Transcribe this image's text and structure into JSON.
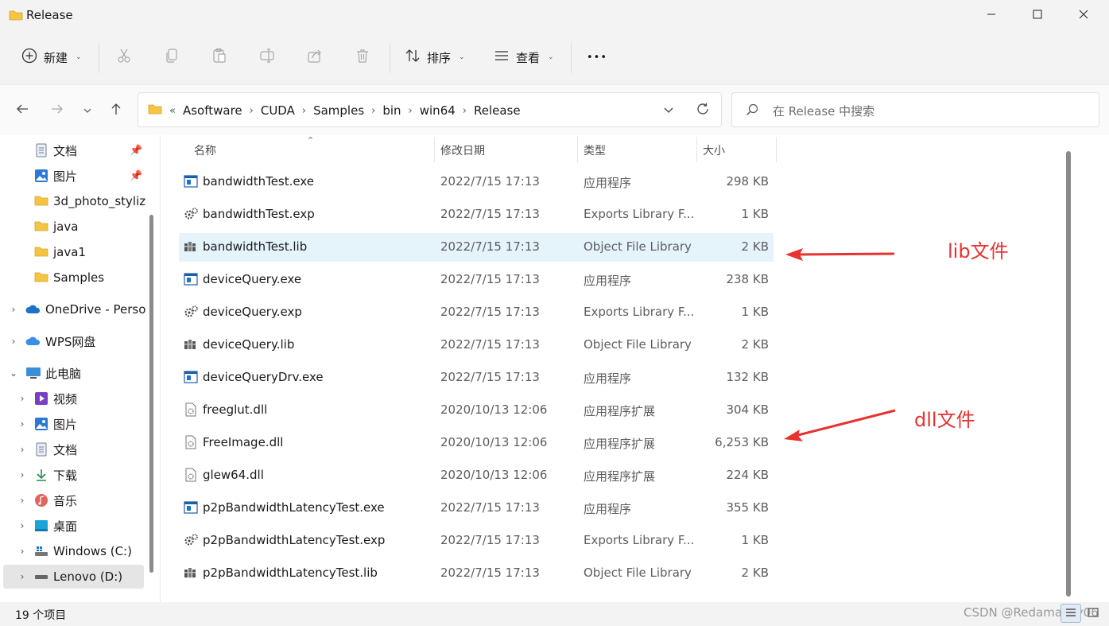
{
  "window": {
    "title": "Release",
    "controls": {
      "minimize": "minimize-icon",
      "maximize": "maximize-icon",
      "close": "close-icon"
    }
  },
  "toolbar": {
    "new_label": "新建",
    "sort_label": "排序",
    "view_label": "查看",
    "more_label": "•••",
    "icons": [
      "cut-icon",
      "copy-icon",
      "paste-icon",
      "rename-icon",
      "share-icon",
      "delete-icon"
    ]
  },
  "address": {
    "overflow": "«",
    "crumbs": [
      "Asoftware",
      "CUDA",
      "Samples",
      "bin",
      "win64",
      "Release"
    ],
    "search_placeholder": "在 Release 中搜索"
  },
  "sidebar": {
    "items": [
      {
        "label": "文档",
        "icon": "document-icon",
        "pinned": true
      },
      {
        "label": "图片",
        "icon": "picture-icon",
        "pinned": true
      },
      {
        "label": "3d_photo_styliz",
        "icon": "folder-icon"
      },
      {
        "label": "java",
        "icon": "folder-icon"
      },
      {
        "label": "java1",
        "icon": "folder-icon"
      },
      {
        "label": "Samples",
        "icon": "folder-icon"
      },
      {
        "label": "OneDrive - Perso",
        "icon": "onedrive-icon"
      },
      {
        "label": "WPS网盘",
        "icon": "wps-cloud-icon"
      },
      {
        "label": "此电脑",
        "icon": "this-pc-icon"
      },
      {
        "label": "视频",
        "icon": "video-icon"
      },
      {
        "label": "图片",
        "icon": "picture-icon"
      },
      {
        "label": "文档",
        "icon": "document-icon"
      },
      {
        "label": "下载",
        "icon": "download-icon"
      },
      {
        "label": "音乐",
        "icon": "music-icon"
      },
      {
        "label": "桌面",
        "icon": "desktop-icon"
      },
      {
        "label": "Windows (C:)",
        "icon": "drive-icon"
      },
      {
        "label": "Lenovo (D:)",
        "icon": "drive-icon"
      }
    ]
  },
  "columns": {
    "name": "名称",
    "date": "修改日期",
    "type": "类型",
    "size": "大小"
  },
  "files": [
    {
      "name": "bandwidthTest.exe",
      "date": "2022/7/15 17:13",
      "type": "应用程序",
      "size": "298 KB",
      "icon": "exe-icon"
    },
    {
      "name": "bandwidthTest.exp",
      "date": "2022/7/15 17:13",
      "type": "Exports Library F...",
      "size": "1 KB",
      "icon": "exp-icon"
    },
    {
      "name": "bandwidthTest.lib",
      "date": "2022/7/15 17:13",
      "type": "Object File Library",
      "size": "2 KB",
      "icon": "lib-icon"
    },
    {
      "name": "deviceQuery.exe",
      "date": "2022/7/15 17:13",
      "type": "应用程序",
      "size": "238 KB",
      "icon": "exe-icon"
    },
    {
      "name": "deviceQuery.exp",
      "date": "2022/7/15 17:13",
      "type": "Exports Library F...",
      "size": "1 KB",
      "icon": "exp-icon"
    },
    {
      "name": "deviceQuery.lib",
      "date": "2022/7/15 17:13",
      "type": "Object File Library",
      "size": "2 KB",
      "icon": "lib-icon"
    },
    {
      "name": "deviceQueryDrv.exe",
      "date": "2022/7/15 17:13",
      "type": "应用程序",
      "size": "132 KB",
      "icon": "exe-icon"
    },
    {
      "name": "freeglut.dll",
      "date": "2020/10/13 12:06",
      "type": "应用程序扩展",
      "size": "304 KB",
      "icon": "dll-icon"
    },
    {
      "name": "FreeImage.dll",
      "date": "2020/10/13 12:06",
      "type": "应用程序扩展",
      "size": "6,253 KB",
      "icon": "dll-icon"
    },
    {
      "name": "glew64.dll",
      "date": "2020/10/13 12:06",
      "type": "应用程序扩展",
      "size": "224 KB",
      "icon": "dll-icon"
    },
    {
      "name": "p2pBandwidthLatencyTest.exe",
      "date": "2022/7/15 17:13",
      "type": "应用程序",
      "size": "355 KB",
      "icon": "exe-icon"
    },
    {
      "name": "p2pBandwidthLatencyTest.exp",
      "date": "2022/7/15 17:13",
      "type": "Exports Library F...",
      "size": "1 KB",
      "icon": "exp-icon"
    },
    {
      "name": "p2pBandwidthLatencyTest.lib",
      "date": "2022/7/15 17:13",
      "type": "Object File Library",
      "size": "2 KB",
      "icon": "lib-icon"
    }
  ],
  "annotations": {
    "lib": "lib文件",
    "dll": "dll文件",
    "color": "#e8322f"
  },
  "status": {
    "item_count": "19 个项目",
    "watermark": "CSDN @Redamancy06"
  },
  "colors": {
    "selected_row": "#e5f3fb",
    "folder": "#f4c542",
    "accent": "#1a73c7"
  }
}
